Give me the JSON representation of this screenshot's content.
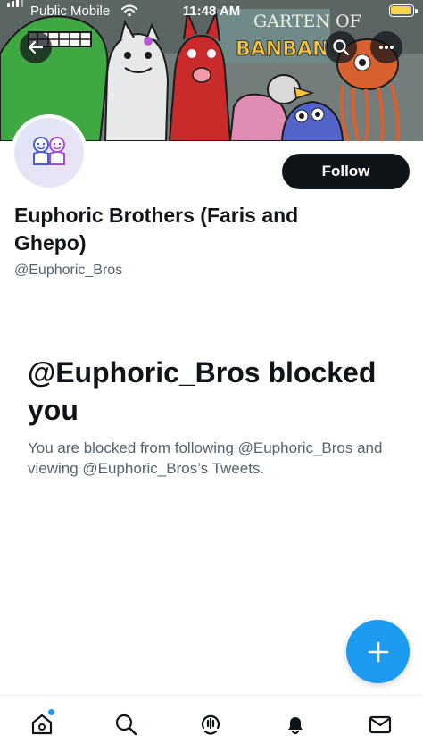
{
  "status_bar": {
    "carrier": "Public Mobile",
    "time": "11:48 AM"
  },
  "banner": {
    "text_line1": "GARTEN OF",
    "text_line2": "BANBAN"
  },
  "profile": {
    "display_name": "Euphoric Brothers (Faris and Ghepo)",
    "handle": "@Euphoric_Bros",
    "follow_label": "Follow"
  },
  "blocked": {
    "title": "@Euphoric_Bros blocked you",
    "description": "You are blocked from following @Euphoric_Bros and viewing @Euphoric_Bros’s Tweets."
  },
  "icons": {
    "back": "arrow-left-icon",
    "search": "search-icon",
    "more": "more-icon",
    "compose": "plus-icon",
    "tabs": [
      "home-icon",
      "search-icon",
      "spaces-icon",
      "notifications-icon",
      "messages-icon"
    ]
  },
  "colors": {
    "accent": "#1d9bf0",
    "text_primary": "#0f1419",
    "text_secondary": "#536471"
  }
}
